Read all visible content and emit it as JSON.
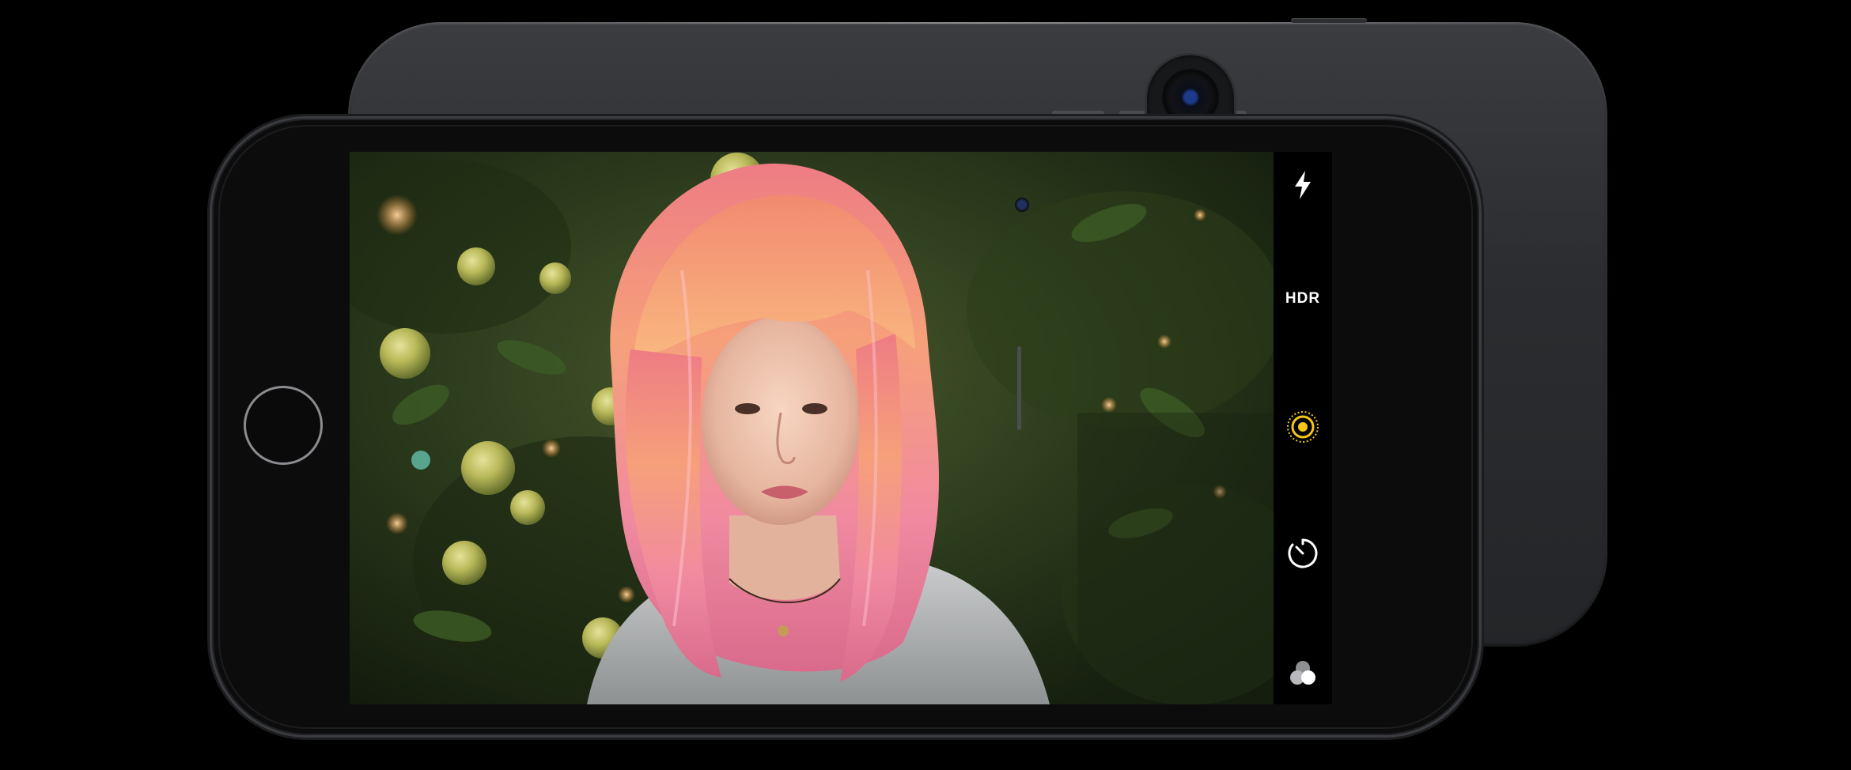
{
  "camera": {
    "controls": {
      "flash": {
        "icon": "flash-icon"
      },
      "hdr": {
        "label": "HDR",
        "icon": "hdr-label"
      },
      "live_photo": {
        "icon": "live-photo-icon",
        "color": "#f5c518"
      },
      "timer": {
        "icon": "timer-icon"
      },
      "filters": {
        "icon": "filters-icon"
      }
    }
  },
  "colors": {
    "background": "#000000",
    "device": "#2b2d30",
    "accent_yellow": "#f5c518",
    "hair_pink": "#f08a96"
  }
}
